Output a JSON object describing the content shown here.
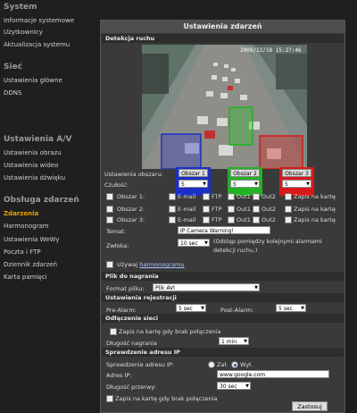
{
  "sidebar": {
    "system_heading": "System",
    "system_items": [
      "Informacje systemowe",
      "Użytkownicy",
      "Aktualizacja systemu"
    ],
    "network_heading": "Sieć",
    "network_items": [
      "Ustawienia główne",
      "DDNS"
    ],
    "av_heading": "Ustawienia A/V",
    "av_items": [
      "Ustawienia obrazu",
      "Ustawienia wideo",
      "Ustawienia dźwięku"
    ],
    "events_heading": "Obsługa zdarzeń",
    "events_items": [
      "Zdarzenia",
      "Harmonogram",
      "Ustawienia WeWy",
      "Poczta i FTP",
      "Dziennik zdarzeń",
      "Karta pamięci"
    ]
  },
  "main": {
    "title": "Ustawienia zdarzeń",
    "motion_section": "Detekcja ruchu",
    "timestamp": "2009/12/18 15:27:46",
    "area_settings_label": "Ustawienia obszaru:",
    "sensitivity_label": "Czułość:",
    "areas": [
      {
        "button": "Obszar 1",
        "sensitivity": "5",
        "color": "#1c2fc4"
      },
      {
        "button": "Obszar 2",
        "sensitivity": "5",
        "color": "#22b322"
      },
      {
        "button": "Obszar 3",
        "sensitivity": "5",
        "color": "#d81818"
      }
    ],
    "area_rows": [
      "Obszar 1:",
      "Obszar 2:",
      "Obszar 3:"
    ],
    "action_labels": [
      "E-mail",
      "FTP",
      "Out1",
      "Out2",
      "Zapis na kartę"
    ],
    "subject_label": "Temat:",
    "subject_value": "IP Camera Warning!",
    "delay_label": "Zwłoka:",
    "delay_value": "10 sec",
    "delay_note": "(Odstęp pomiędzy kolejnymi alarmami detekcji ruchu.)",
    "schedule_checkbox_label": "Używaj",
    "schedule_link": "harmonogramu",
    "file_section": "Plik do nagrania",
    "file_format_label": "Format pliku:",
    "file_format_value": "Plik AVI",
    "record_section": "Ustawienia rejestracji",
    "pre_alarm_label": "Pre-Alarm:",
    "pre_alarm_value": "5 sec",
    "post_alarm_label": "Post-Alarm:",
    "post_alarm_value": "5 sec",
    "disconnect_section": "Odłączenie sieci",
    "disconnect_save_label": "Zapis na kartę gdy brak połączenia",
    "record_length_label": "Długość nagrania",
    "record_length_value": "1 min",
    "ipcheck_section": "Sprawdzenie adresu IP",
    "ipcheck_label": "Sprawdzenie adresu IP:",
    "ipcheck_on": "Zał.",
    "ipcheck_off": "Wył.",
    "ip_address_label": "Adres IP:",
    "ip_address_value": "www.google.com",
    "interval_label": "Długość przerwy:",
    "interval_value": "30 sec",
    "ipcheck_save_label": "Zapis na kartę gdy brak połączenia",
    "save_button": "Zastosuj"
  }
}
